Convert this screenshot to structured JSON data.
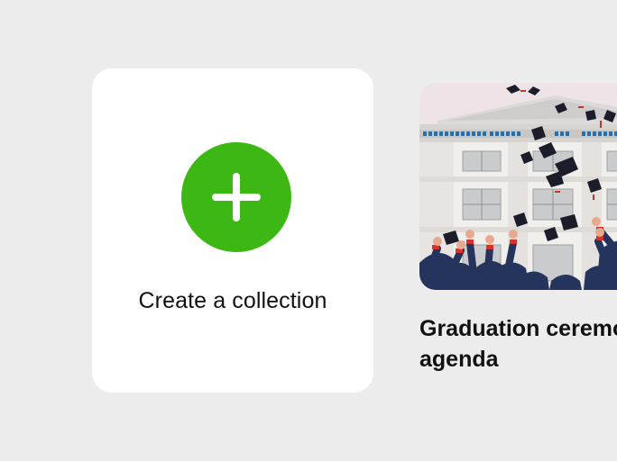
{
  "create_card": {
    "label": "Create a collection",
    "icon": "plus-icon",
    "accent_color": "#3cb714"
  },
  "collection_card": {
    "title_lines": [
      "Graduation ceremony",
      "agenda"
    ],
    "image_description_icon": "graduation-photo"
  }
}
